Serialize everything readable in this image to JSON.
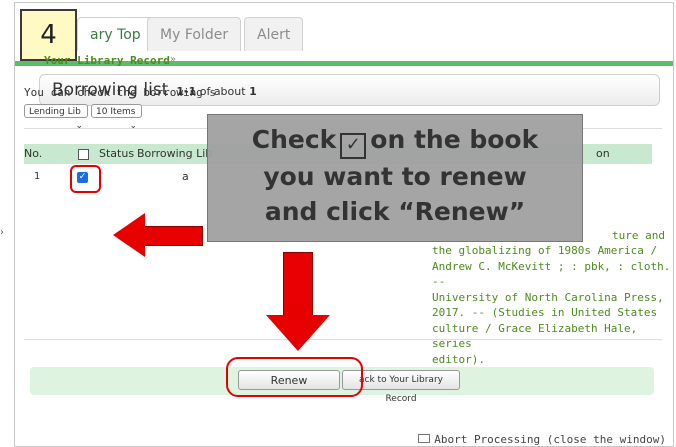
{
  "tabs": [
    {
      "label": "ary Top",
      "active": true
    },
    {
      "label": "My Folder",
      "active": false
    },
    {
      "label": "Alert",
      "active": false
    }
  ],
  "step_number": "4",
  "panel": {
    "title": "Borrowing list",
    "count_range": "1-1",
    "count_text": "of about",
    "count_total": "1"
  },
  "record_link": "Your Library Record",
  "crumb_sep": "»",
  "check_text": "You can check the borrowing s",
  "filters": {
    "lib_select": "Lending Lib",
    "items_select": "10 Items"
  },
  "table": {
    "headers": {
      "no": "No.",
      "status": "Status",
      "borrowing_lib": "Borrowing Lib",
      "description": "on"
    },
    "row": {
      "no": "1",
      "checked": true,
      "partial": "a",
      "desc_tail": "ture and",
      "description": "the globalizing of 1980s America /\nAndrew C. McKevitt ; : pbk, : cloth. --\nUniversity of North Carolina Press,\n2017. -- (Studies in United States\nculture / Grace Elizabeth Hale, series\neditor)."
    }
  },
  "buttons": {
    "renew": "Renew",
    "back": "ack to Your Library Record"
  },
  "abort": "Abort Processing (close the window)",
  "callout": {
    "line1_a": "Check",
    "line1_icon": "✓",
    "line1_b": "on the book",
    "line2": "you want to renew",
    "line3": "and click “Renew”"
  },
  "outside_mark": "›",
  "colors": {
    "accent_green": "#5dbb6b",
    "link_green": "#4e8a1f",
    "highlight_red": "#e60000",
    "step_yellow": "#fff9c4"
  }
}
